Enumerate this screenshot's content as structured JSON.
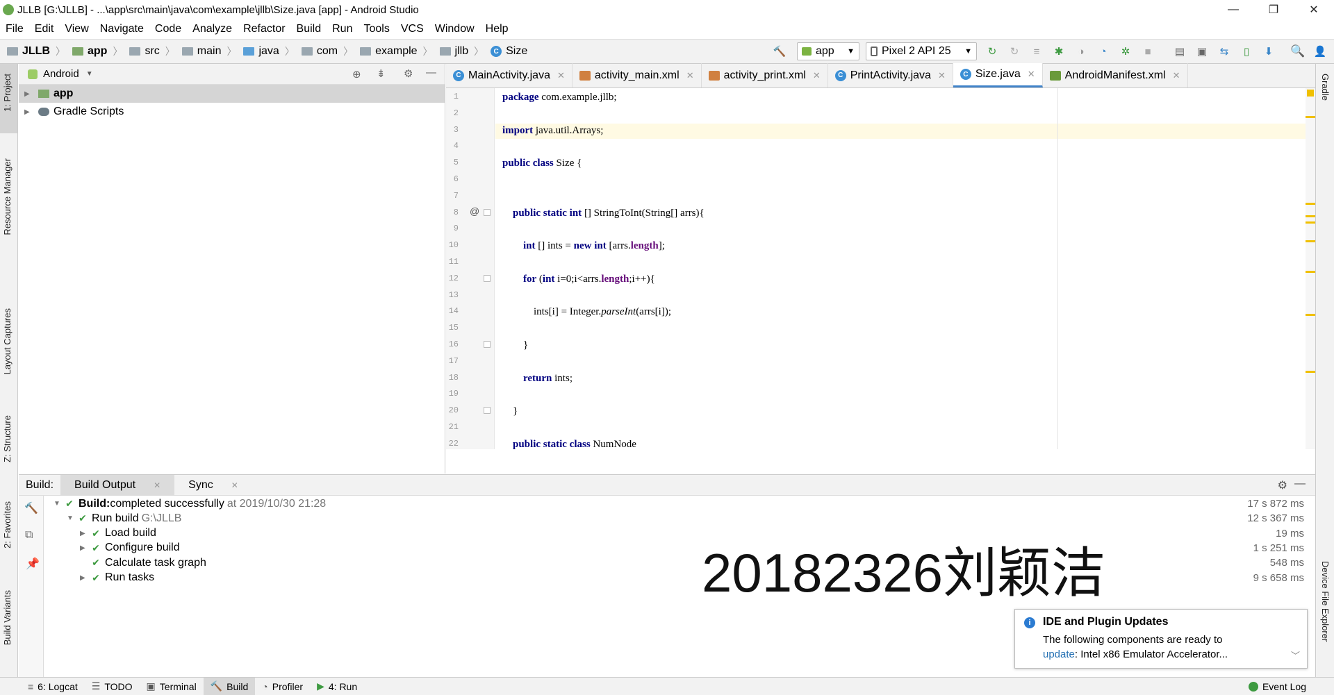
{
  "window": {
    "title": "JLLB [G:\\JLLB] - ...\\app\\src\\main\\java\\com\\example\\jllb\\Size.java [app] - Android Studio",
    "minimize": "—",
    "restore": "❐",
    "close": "✕"
  },
  "menu": [
    "File",
    "Edit",
    "View",
    "Navigate",
    "Code",
    "Analyze",
    "Refactor",
    "Build",
    "Run",
    "Tools",
    "VCS",
    "Window",
    "Help"
  ],
  "breadcrumb": [
    "JLLB",
    "app",
    "src",
    "main",
    "java",
    "com",
    "example",
    "jllb",
    "Size"
  ],
  "toolbar": {
    "run_config": "app",
    "device": "Pixel 2 API 25"
  },
  "project_panel": {
    "view": "Android",
    "tree": [
      {
        "label": "app",
        "bold": true
      },
      {
        "label": "Gradle Scripts",
        "bold": false
      }
    ]
  },
  "editor": {
    "tabs": [
      {
        "label": "MainActivity.java",
        "kind": "java"
      },
      {
        "label": "activity_main.xml",
        "kind": "xml"
      },
      {
        "label": "activity_print.xml",
        "kind": "xml"
      },
      {
        "label": "PrintActivity.java",
        "kind": "java"
      },
      {
        "label": "Size.java",
        "kind": "java",
        "active": true
      },
      {
        "label": "AndroidManifest.xml",
        "kind": "manifest"
      }
    ],
    "line_numbers": [
      "1",
      "2",
      "3",
      "4",
      "5",
      "6",
      "7",
      "8",
      "9",
      "10",
      "11",
      "12",
      "13",
      "14",
      "15",
      "16",
      "17",
      "18",
      "19",
      "20",
      "21",
      "22"
    ],
    "code": [
      {
        "n": 1,
        "tokens": [
          [
            "kw",
            "package"
          ],
          [
            "",
            "com.example.jllb;"
          ]
        ]
      },
      {
        "n": 3,
        "tokens": [
          [
            "kw",
            "import"
          ],
          [
            "",
            "java.util.Arrays;"
          ]
        ]
      },
      {
        "n": 5,
        "tokens": [
          [
            "kw",
            "public class"
          ],
          [
            "",
            "Size {"
          ]
        ]
      },
      {
        "n": 8,
        "tokens": [
          [
            "",
            "    "
          ],
          [
            "kw",
            "public static int"
          ],
          [
            "",
            "[] StringToInt(String[] arrs){"
          ]
        ]
      },
      {
        "n": 10,
        "tokens": [
          [
            "",
            "        "
          ],
          [
            "kw",
            "int"
          ],
          [
            "",
            "[] ints = "
          ],
          [
            "kw",
            "new int"
          ],
          [
            "",
            "[arrs."
          ],
          [
            "fld",
            "length"
          ],
          [
            "",
            "];"
          ]
        ]
      },
      {
        "n": 12,
        "tokens": [
          [
            "",
            "        "
          ],
          [
            "kw",
            "for"
          ],
          [
            "",
            "("
          ],
          [
            "kw",
            "int"
          ],
          [
            "",
            "i=0;i<arrs."
          ],
          [
            "fld",
            "length"
          ],
          [
            "",
            ";i++){"
          ]
        ]
      },
      {
        "n": 14,
        "tokens": [
          [
            "",
            "            ints[i] = Integer."
          ],
          [
            "it",
            "parseInt"
          ],
          [
            "",
            "(arrs[i]);"
          ]
        ]
      },
      {
        "n": 16,
        "tokens": [
          [
            "",
            "        }"
          ]
        ]
      },
      {
        "n": 18,
        "tokens": [
          [
            "",
            "        "
          ],
          [
            "kw",
            "return"
          ],
          [
            "",
            "ints;"
          ]
        ]
      },
      {
        "n": 20,
        "tokens": [
          [
            "",
            "    }"
          ]
        ]
      },
      {
        "n": 22,
        "tokens": [
          [
            "",
            "    "
          ],
          [
            "kw",
            "public static class"
          ],
          [
            "",
            "NumNode"
          ]
        ]
      }
    ],
    "gutter_at": "@"
  },
  "build": {
    "header_label": "Build:",
    "tabs": [
      "Build Output",
      "Sync"
    ],
    "rows": [
      {
        "indent": 0,
        "expand": "▼",
        "bold": "Build:",
        "text": "completed successfully",
        "gray": "at 2019/10/30 21:28",
        "time": "17 s 872 ms"
      },
      {
        "indent": 1,
        "expand": "▼",
        "bold": "",
        "text": "Run build",
        "gray": "G:\\JLLB",
        "time": "12 s 367 ms"
      },
      {
        "indent": 2,
        "expand": "▶",
        "bold": "",
        "text": "Load build",
        "gray": "",
        "time": "19 ms"
      },
      {
        "indent": 2,
        "expand": "▶",
        "bold": "",
        "text": "Configure build",
        "gray": "",
        "time": "1 s 251 ms"
      },
      {
        "indent": 2,
        "expand": "",
        "bold": "",
        "text": "Calculate task graph",
        "gray": "",
        "time": "548 ms"
      },
      {
        "indent": 2,
        "expand": "▶",
        "bold": "",
        "text": "Run tasks",
        "gray": "",
        "time": "9 s 658 ms"
      }
    ]
  },
  "watermark": "20182326刘颖洁",
  "notification": {
    "title": "IDE and Plugin Updates",
    "line1": "The following components are ready to",
    "link": "update",
    "line2": ": Intel x86 Emulator Accelerator..."
  },
  "left_stripe": [
    "1: Project",
    "Resource Manager",
    "Layout Captures",
    "Z: Structure",
    "2: Favorites",
    "Build Variants"
  ],
  "right_stripe": [
    "Gradle",
    "Device File Explorer"
  ],
  "statusbar": {
    "items": [
      "6: Logcat",
      "TODO",
      "Terminal",
      "Build",
      "Profiler",
      "4: Run"
    ],
    "event_log": "Event Log"
  },
  "colors": {
    "keyword": "#000080",
    "field": "#660e7a",
    "success": "#3d9a40",
    "accent": "#4083c9",
    "link": "#2470b3"
  }
}
